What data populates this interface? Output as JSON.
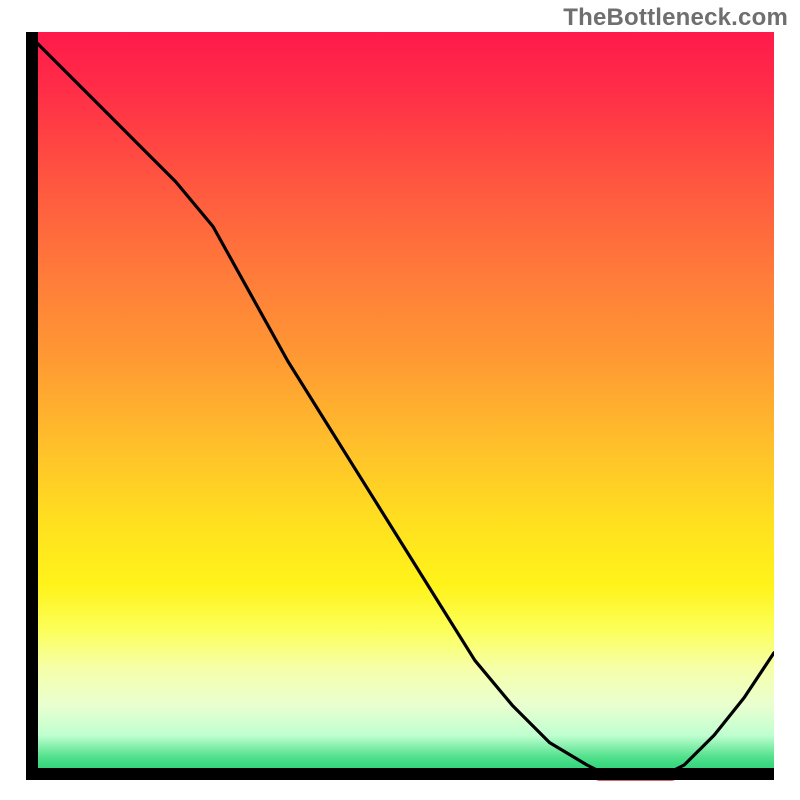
{
  "watermark": "TheBottleneck.com",
  "colors": {
    "gradient_top": "#ff1a4b",
    "gradient_mid": "#ffe11f",
    "gradient_bottom": "#17c76f",
    "curve": "#000000",
    "marker": "#d66a6a",
    "axis": "#000000"
  },
  "chart_data": {
    "type": "line",
    "title": "",
    "xlabel": "",
    "ylabel": "",
    "xlim": [
      0,
      100
    ],
    "ylim": [
      0,
      100
    ],
    "x": [
      0,
      5,
      10,
      15,
      20,
      25,
      30,
      35,
      40,
      45,
      50,
      55,
      60,
      65,
      70,
      75,
      78,
      80,
      82,
      85,
      88,
      92,
      96,
      100
    ],
    "values": [
      100,
      95,
      90,
      85,
      80,
      74,
      65,
      56,
      48,
      40,
      32,
      24,
      16,
      10,
      5,
      2,
      0.5,
      0,
      0,
      0.5,
      2,
      6,
      11,
      17
    ],
    "marker": {
      "x_start": 76,
      "x_end": 87,
      "y": 0.5
    }
  }
}
